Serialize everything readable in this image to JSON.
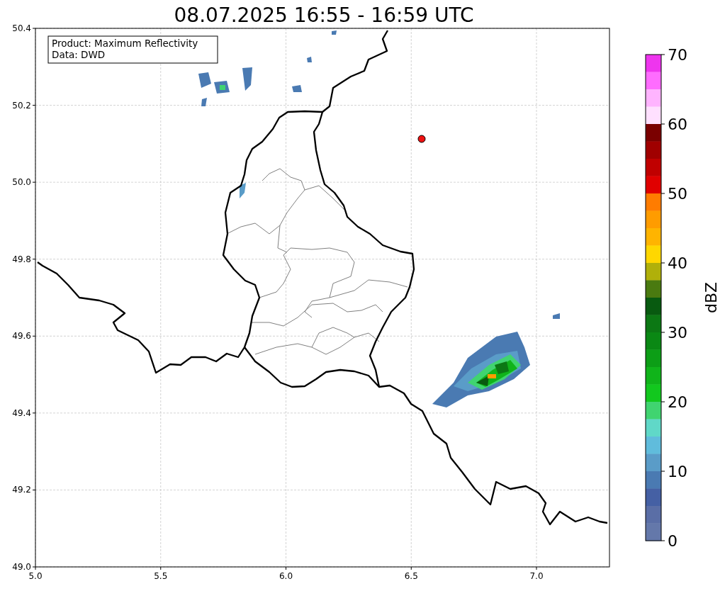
{
  "title": "08.07.2025 16:55 - 16:59 UTC",
  "info_box": {
    "lines": [
      "Product: Maximum Reflectivity",
      "Data: DWD"
    ]
  },
  "map": {
    "x_ticks": [
      "5.0",
      "5.5",
      "6.0",
      "6.5",
      "7.0"
    ],
    "y_ticks": [
      "50.4",
      "50.2",
      "50.0",
      "49.8",
      "49.6",
      "49.4",
      "49.2",
      "49.0"
    ]
  },
  "colorbar": {
    "label": "dBZ",
    "ticks": [
      "70",
      "60",
      "50",
      "40",
      "30",
      "20",
      "10",
      "0"
    ],
    "segments": [
      {
        "color": "#ee35ee"
      },
      {
        "color": "#ff6cff"
      },
      {
        "color": "#ffb4ff"
      },
      {
        "color": "#ffe0ff"
      },
      {
        "color": "#7a0000"
      },
      {
        "color": "#a00000"
      },
      {
        "color": "#c00000"
      },
      {
        "color": "#e00000"
      },
      {
        "color": "#ff7c00"
      },
      {
        "color": "#ff9c00"
      },
      {
        "color": "#ffb400"
      },
      {
        "color": "#ffd700"
      },
      {
        "color": "#b0b00a"
      },
      {
        "color": "#4a7a10"
      },
      {
        "color": "#085a10"
      },
      {
        "color": "#0c7814"
      },
      {
        "color": "#0a8814"
      },
      {
        "color": "#0c9e16"
      },
      {
        "color": "#10b41a"
      },
      {
        "color": "#12c81e"
      },
      {
        "color": "#40d470"
      },
      {
        "color": "#60d8c8"
      },
      {
        "color": "#60bcdc"
      },
      {
        "color": "#5a9cc8"
      },
      {
        "color": "#4a7ab2"
      },
      {
        "color": "#4560a4"
      },
      {
        "color": "#5a6ea6"
      },
      {
        "color": "#6478aa"
      }
    ]
  }
}
